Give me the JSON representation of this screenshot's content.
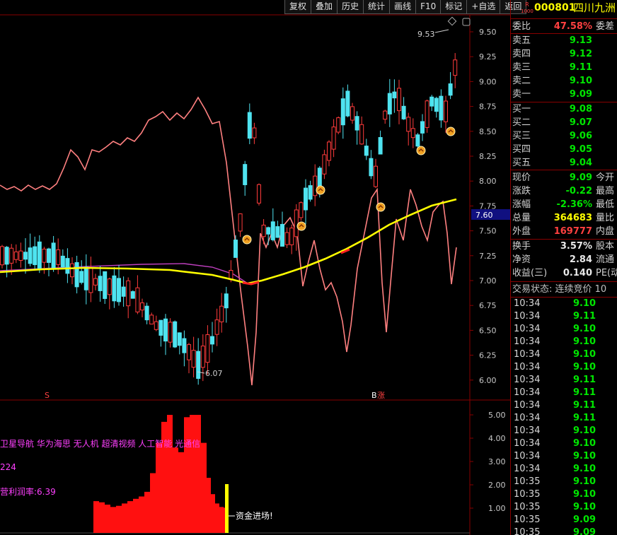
{
  "toolbar": [
    "复权",
    "叠加",
    "历史",
    "统计",
    "画线",
    "F10",
    "标记",
    "+自选",
    "返回"
  ],
  "stock": {
    "code": "000801",
    "name": "四川九洲",
    "badge_top": "R",
    "badge_bottom": "1000"
  },
  "quote": {
    "weibi_label": "委比",
    "weibi_value": "47.58%",
    "weicha_label": "委差",
    "sells": [
      {
        "label": "卖五",
        "price": "9.13"
      },
      {
        "label": "卖四",
        "price": "9.12"
      },
      {
        "label": "卖三",
        "price": "9.11"
      },
      {
        "label": "卖二",
        "price": "9.10"
      },
      {
        "label": "卖一",
        "price": "9.09"
      }
    ],
    "buys": [
      {
        "label": "买一",
        "price": "9.08"
      },
      {
        "label": "买二",
        "price": "9.07"
      },
      {
        "label": "买三",
        "price": "9.06"
      },
      {
        "label": "买四",
        "price": "9.05"
      },
      {
        "label": "买五",
        "price": "9.04"
      }
    ],
    "stats": [
      {
        "label": "现价",
        "value": "9.09",
        "color": "green",
        "extra": "今开"
      },
      {
        "label": "涨跌",
        "value": "-0.22",
        "color": "green",
        "extra": "最高"
      },
      {
        "label": "涨幅",
        "value": "-2.36%",
        "color": "green",
        "extra": "最低"
      },
      {
        "label": "总量",
        "value": "364683",
        "color": "yellow",
        "extra": "量比"
      },
      {
        "label": "外盘",
        "value": "169777",
        "color": "red",
        "extra": "内盘"
      }
    ],
    "stats2": [
      {
        "label": "换手",
        "value": "3.57%",
        "extra": "股本"
      },
      {
        "label": "净资",
        "value": "2.84",
        "extra": "流通"
      },
      {
        "label": "收益(三)",
        "value": "0.140",
        "extra": "PE(动"
      }
    ],
    "trade_state": "交易状态: 连续竞价 10",
    "ticks": [
      {
        "t": "10:34",
        "p": "9.10"
      },
      {
        "t": "10:34",
        "p": "9.11"
      },
      {
        "t": "10:34",
        "p": "9.10"
      },
      {
        "t": "10:34",
        "p": "9.10"
      },
      {
        "t": "10:34",
        "p": "9.10"
      },
      {
        "t": "10:34",
        "p": "9.10"
      },
      {
        "t": "10:34",
        "p": "9.11"
      },
      {
        "t": "10:34",
        "p": "9.11"
      },
      {
        "t": "10:34",
        "p": "9.11"
      },
      {
        "t": "10:34",
        "p": "9.11"
      },
      {
        "t": "10:34",
        "p": "9.10"
      },
      {
        "t": "10:34",
        "p": "9.10"
      },
      {
        "t": "10:34",
        "p": "9.10"
      },
      {
        "t": "10:34",
        "p": "9.10"
      },
      {
        "t": "10:35",
        "p": "9.10"
      },
      {
        "t": "10:35",
        "p": "9.10"
      },
      {
        "t": "10:35",
        "p": "9.10"
      },
      {
        "t": "10:35",
        "p": "9.09"
      },
      {
        "t": "10:35",
        "p": "9.09"
      }
    ]
  },
  "price_axis": [
    "9.50",
    "9.25",
    "9.00",
    "8.75",
    "8.50",
    "8.25",
    "8.00",
    "7.75",
    "7.50",
    "7.25",
    "7.00",
    "6.75",
    "6.50",
    "6.25",
    "6.00"
  ],
  "price_marker": "7.60",
  "high_label": "9.53",
  "low_label": "6.07",
  "s_label": "S",
  "b_label": "B",
  "zhang_label": "涨",
  "vol_axis": [
    "5.00",
    "4.00",
    "3.00",
    "2.00",
    "1.00"
  ],
  "overlay": {
    "line1": "卫星导航 华为海思 无人机 超清视频 人工智能 光通信",
    "line2": "224",
    "line3": "营利润率:6.39"
  },
  "fund_label": "资金进场!",
  "colors": {
    "up": "#ff3b3b",
    "down": "#4fe3f0",
    "ma": "#ffff00",
    "pink": "#ff8080",
    "purple": "#c040c0",
    "border": "#880000"
  }
}
